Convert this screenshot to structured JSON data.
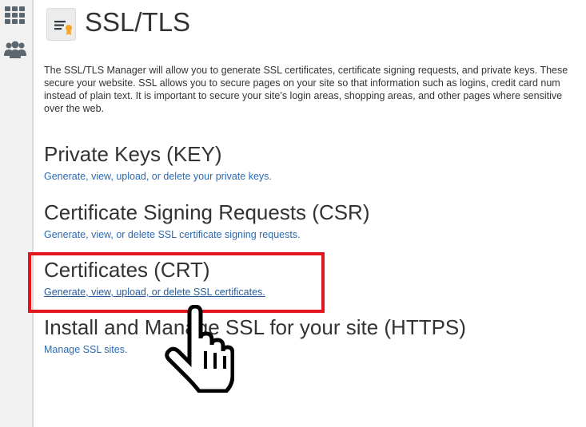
{
  "sidebar": {
    "icons": [
      {
        "name": "apps-grid-icon"
      },
      {
        "name": "users-icon"
      }
    ]
  },
  "page": {
    "title": "SSL/TLS",
    "intro_lines": [
      "The SSL/TLS Manager will allow you to generate SSL certificates, certificate signing requests, and private keys. These",
      "secure your website. SSL allows you to secure pages on your site so that information such as logins, credit card num",
      "instead of plain text. It is important to secure your site’s login areas, shopping areas, and other pages where sensitive",
      "over the web."
    ]
  },
  "sections": {
    "keys": {
      "title": "Private Keys (KEY)",
      "link": "Generate, view, upload, or delete your private keys."
    },
    "csr": {
      "title": "Certificate Signing Requests (CSR)",
      "link": "Generate, view, or delete SSL certificate signing requests."
    },
    "crt": {
      "title": "Certificates (CRT)",
      "link": "Generate, view, upload, or delete SSL certificates."
    },
    "https": {
      "title": "Install and Manage SSL for your site (HTTPS)",
      "link": "Manage SSL sites."
    }
  },
  "colors": {
    "link": "#2a6ab3",
    "highlight": "#e3151d",
    "sidebar_bg": "#f1f1f1"
  }
}
